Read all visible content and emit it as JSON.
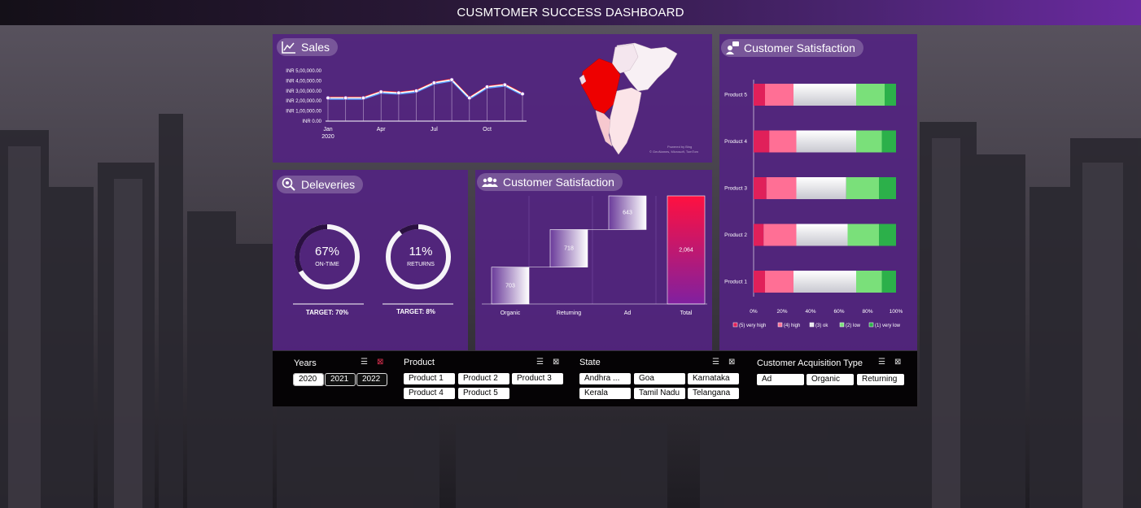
{
  "title": "CUSMTOMER SUCCESS DASHBOARD",
  "sales": {
    "label": "Sales",
    "chart_data": {
      "type": "line",
      "y_ticks": [
        "INR 5,00,000.00",
        "INR 4,00,000.00",
        "INR 3,00,000.00",
        "INR 2,00,000.00",
        "INR 1,00,000.00",
        "INR 0.00"
      ],
      "x_ticks": [
        "Jan",
        "Apr",
        "Jul",
        "Oct"
      ],
      "x_sub": "2020",
      "ylim": [
        0,
        500000
      ],
      "x": [
        "Jan",
        "Feb",
        "Mar",
        "Apr",
        "May",
        "Jun",
        "Jul",
        "Aug",
        "Sep",
        "Oct",
        "Nov",
        "Dec"
      ],
      "series": [
        {
          "values": [
            230000,
            230000,
            230000,
            290000,
            280000,
            300000,
            380000,
            410000,
            230000,
            340000,
            360000,
            270000
          ]
        }
      ]
    },
    "map_credit": "Powered by Bing\n© GeoNames, Microsoft, TomTom"
  },
  "deliveries": {
    "label": "Deleveries",
    "on_time": {
      "value": "67%",
      "caption": "ON-TIME",
      "fraction": 0.67,
      "target": "TARGET: 70%"
    },
    "returns": {
      "value": "11%",
      "caption": "RETURNS",
      "fraction": 0.11,
      "target": "TARGET: 8%"
    }
  },
  "satisfaction_waterfall": {
    "label": "Customer Satisfaction",
    "chart_data": {
      "type": "bar",
      "categories": [
        "Organic",
        "Returning",
        "Ad",
        "Total"
      ],
      "values": [
        703,
        718,
        643,
        2064
      ],
      "labels": [
        "703",
        "718",
        "643",
        "2,064"
      ]
    }
  },
  "satisfaction_stacked": {
    "label": "Customer Satisfaction",
    "chart_data": {
      "type": "bar",
      "categories": [
        "Product 5",
        "Product 4",
        "Product 3",
        "Product 2",
        "Product 1"
      ],
      "x_ticks": [
        "0%",
        "20%",
        "40%",
        "60%",
        "80%",
        "100%"
      ],
      "series": [
        {
          "name": "(5) very high",
          "color": "#e0205a",
          "values": [
            8,
            11,
            9,
            7,
            8
          ]
        },
        {
          "name": "(4) high",
          "color": "#ff6f95",
          "values": [
            20,
            19,
            21,
            23,
            20
          ]
        },
        {
          "name": "(3) ok",
          "color": "#e8e8ec",
          "values": [
            44,
            42,
            35,
            36,
            44
          ]
        },
        {
          "name": "(2) low",
          "color": "#7ae07a",
          "values": [
            20,
            18,
            23,
            22,
            18
          ]
        },
        {
          "name": "(1) very low",
          "color": "#2cb04a",
          "values": [
            8,
            10,
            12,
            12,
            10
          ]
        }
      ]
    }
  },
  "slicers": {
    "years": {
      "header": "Years",
      "items": [
        "2020",
        "2021",
        "2022"
      ]
    },
    "product": {
      "header": "Product",
      "items": [
        "Product 1",
        "Product 2",
        "Product 3",
        "Product 4",
        "Product 5"
      ]
    },
    "state": {
      "header": "State",
      "items": [
        "Andhra ...",
        "Goa",
        "Karnataka",
        "Kerala",
        "Tamil Nadu",
        "Telangana"
      ]
    },
    "acquisition": {
      "header": "Customer Acquisition Type",
      "items": [
        "Ad",
        "Organic",
        "Returning"
      ]
    }
  }
}
